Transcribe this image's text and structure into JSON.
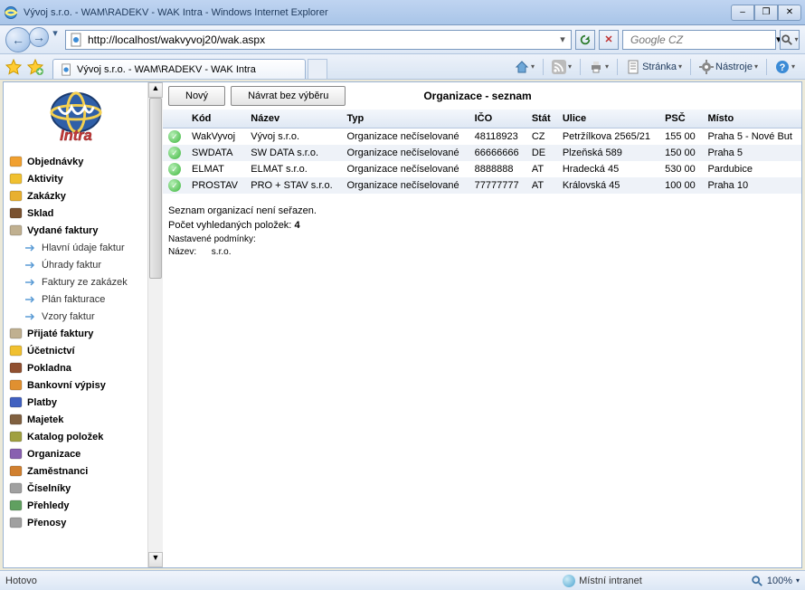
{
  "window": {
    "title": "Vývoj s.r.o. - WAM\\RADEKV - WAK Intra - Windows Internet Explorer",
    "minimize": "–",
    "maximize": "❐",
    "close": "✕"
  },
  "address": {
    "url": "http://localhost/wakvyvoj20/wak.aspx"
  },
  "search": {
    "placeholder": "Google CZ"
  },
  "tab": {
    "title": "Vývoj s.r.o. - WAM\\RADEKV - WAK Intra"
  },
  "tools": {
    "page": "Stránka",
    "tools": "Nástroje"
  },
  "sidebar": {
    "items": [
      {
        "label": "Objednávky"
      },
      {
        "label": "Aktivity"
      },
      {
        "label": "Zakázky"
      },
      {
        "label": "Sklad"
      },
      {
        "label": "Vydané faktury"
      },
      {
        "label": "Hlavní údaje faktur",
        "sub": true
      },
      {
        "label": "Úhrady faktur",
        "sub": true
      },
      {
        "label": "Faktury ze zakázek",
        "sub": true
      },
      {
        "label": "Plán fakturace",
        "sub": true
      },
      {
        "label": "Vzory faktur",
        "sub": true
      },
      {
        "label": "Přijaté faktury"
      },
      {
        "label": "Účetnictví"
      },
      {
        "label": "Pokladna"
      },
      {
        "label": "Bankovní výpisy"
      },
      {
        "label": "Platby"
      },
      {
        "label": "Majetek"
      },
      {
        "label": "Katalog položek"
      },
      {
        "label": "Organizace"
      },
      {
        "label": "Zaměstnanci"
      },
      {
        "label": "Číselníky"
      },
      {
        "label": "Přehledy"
      },
      {
        "label": "Přenosy"
      }
    ]
  },
  "buttons": {
    "new": "Nový",
    "return": "Návrat bez výběru"
  },
  "main": {
    "title": "Organizace - seznam",
    "columns": [
      "",
      "Kód",
      "Název",
      "Typ",
      "IČO",
      "Stát",
      "Ulice",
      "PSČ",
      "Místo"
    ],
    "rows": [
      {
        "kod": "WakVyvoj",
        "nazev": "Vývoj s.r.o.",
        "typ": "Organizace nečíselované",
        "ico": "48118923",
        "stat": "CZ",
        "ulice": "Petržílkova 2565/21",
        "psc": "155 00",
        "misto": "Praha 5 - Nové But"
      },
      {
        "kod": "SWDATA",
        "nazev": "SW DATA s.r.o.",
        "typ": "Organizace nečíselované",
        "ico": "66666666",
        "stat": "DE",
        "ulice": "Plzeňská 589",
        "psc": "150 00",
        "misto": "Praha 5"
      },
      {
        "kod": "ELMAT",
        "nazev": "ELMAT s.r.o.",
        "typ": "Organizace nečíselované",
        "ico": "8888888",
        "stat": "AT",
        "ulice": "Hradecká 45",
        "psc": "530 00",
        "misto": "Pardubice"
      },
      {
        "kod": "PROSTAV",
        "nazev": "PRO + STAV s.r.o.",
        "typ": "Organizace nečíselované",
        "ico": "77777777",
        "stat": "AT",
        "ulice": "Královská 45",
        "psc": "100 00",
        "misto": "Praha 10"
      }
    ],
    "info": {
      "line1": "Seznam organizací není seřazen.",
      "line2_label": "Počet vyhledaných položek:",
      "line2_value": "4",
      "line3": "Nastavené podmínky:",
      "line4_label": "Název:",
      "line4_value": "s.r.o."
    }
  },
  "status": {
    "left": "Hotovo",
    "zone": "Místní intranet",
    "zoom": "100%"
  }
}
